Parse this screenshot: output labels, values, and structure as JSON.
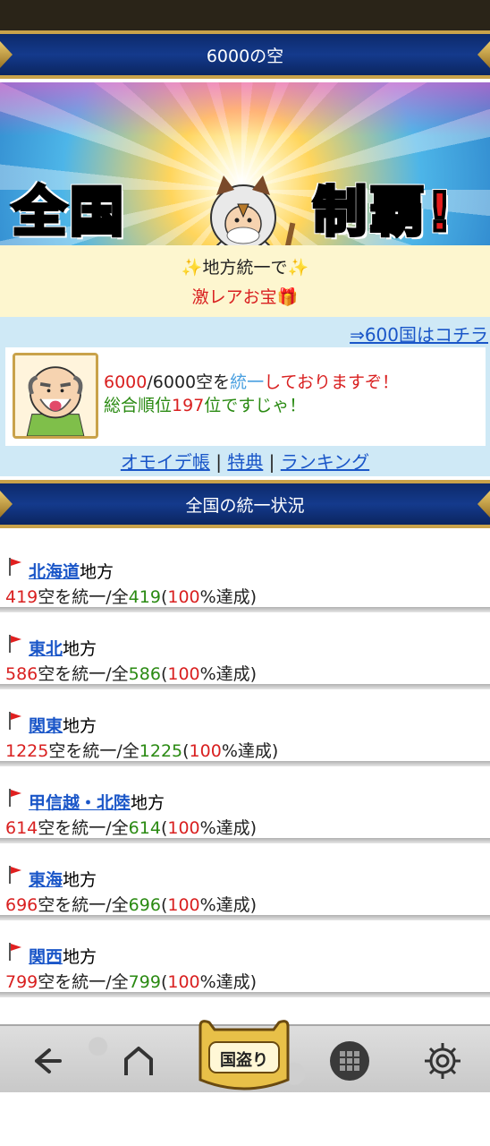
{
  "header": {
    "title": "6000の空"
  },
  "banner": {
    "text_left": "全国",
    "text_right": "制覇!"
  },
  "notice": {
    "line1": "✨地方統一で✨",
    "line2": "激レアお宝🎁"
  },
  "status": {
    "link_600": "⇒600国はコチラ",
    "count_done": "6000",
    "slash": "/",
    "count_total": "6000",
    "text_a": "空を",
    "text_unify": "統一",
    "text_b": "しておりますぞ！",
    "rank_label": "総合順位",
    "rank_value": "197",
    "rank_unit": "位",
    "rank_suffix": "ですじゃ！",
    "links": [
      "オモイデ帳",
      "特典",
      "ランキング"
    ],
    "separator": "|"
  },
  "section": {
    "title": "全国の統一状況"
  },
  "regions": [
    {
      "name": "北海道",
      "suffix": "地方",
      "done": "419",
      "mid": "空を統一/全",
      "total": "419",
      "pct": "100",
      "end": "%達成)"
    },
    {
      "name": "東北",
      "suffix": "地方",
      "done": "586",
      "mid": "空を統一/全",
      "total": "586",
      "pct": "100",
      "end": "%達成)"
    },
    {
      "name": "関東",
      "suffix": "地方",
      "done": "1225",
      "mid": "空を統一/全",
      "total": "1225",
      "pct": "100",
      "end": "%達成)"
    },
    {
      "name": "甲信越・北陸",
      "suffix": "地方",
      "done": "614",
      "mid": "空を統一/全",
      "total": "614",
      "pct": "100",
      "end": "%達成)"
    },
    {
      "name": "東海",
      "suffix": "地方",
      "done": "696",
      "mid": "空を統一/全",
      "total": "696",
      "pct": "100",
      "end": "%達成)"
    },
    {
      "name": "関西",
      "suffix": "地方",
      "done": "799",
      "mid": "空を統一/全",
      "total": "799",
      "pct": "100",
      "end": "%達成)"
    }
  ],
  "open_paren": "(",
  "bottom_nav": {
    "back_icon": "back-arrow-icon",
    "home_icon": "home-icon",
    "center_label": "国盗り",
    "apps_icon": "grid-icon",
    "settings_icon": "gear-icon"
  }
}
